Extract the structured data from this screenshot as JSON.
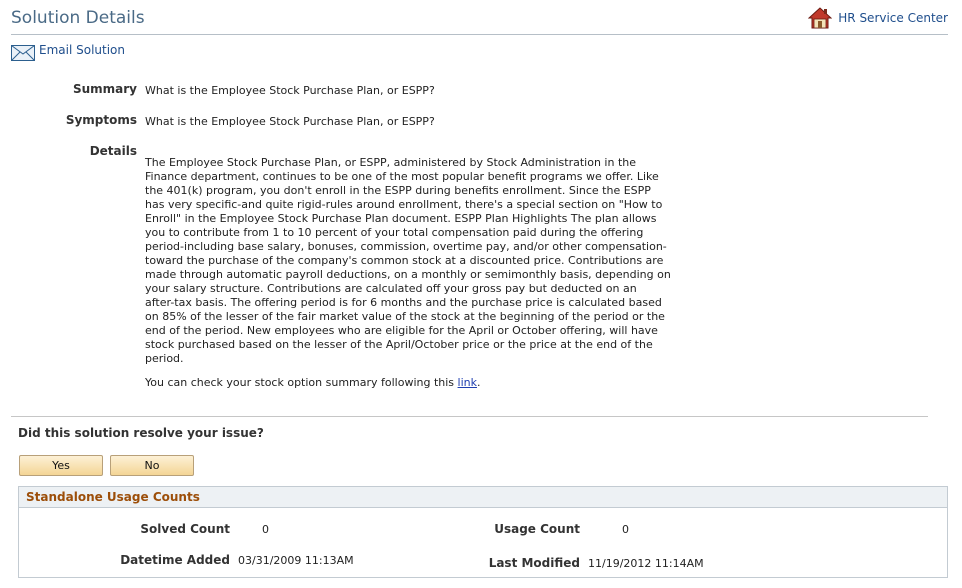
{
  "header": {
    "title": "Solution Details",
    "hr_link": "HR Service Center"
  },
  "actions": {
    "email": "Email Solution"
  },
  "fields": {
    "summary_label": "Summary",
    "summary_value": "What is the Employee Stock Purchase Plan, or ESPP?",
    "symptoms_label": "Symptoms",
    "symptoms_value": "What is the Employee Stock Purchase Plan, or ESPP?",
    "details_label": "Details",
    "details_lines": [
      "The Employee Stock Purchase Plan, or ESPP, administered by Stock Administration in the",
      "Finance department, continues to be one of the most popular benefit programs we offer. Like",
      "the 401(k) program, you don't enroll in the ESPP during benefits enrollment. Since the ESPP",
      "has very specific-and quite rigid-rules around enrollment, there's a special section on \"How to",
      "Enroll\" in the Employee Stock Purchase Plan document. ESPP Plan Highlights The plan allows",
      "you to contribute from 1 to 10 percent of your total compensation paid during the offering",
      "period-including base salary, bonuses, commission, overtime pay, and/or other compensation-",
      "toward the purchase of the company's common stock at a discounted price. Contributions are",
      "made through automatic payroll deductions, on a monthly or semimonthly basis, depending on",
      "your salary structure. Contributions are calculated off your gross pay but deducted on an",
      "after-tax basis. The offering period is for 6 months and the purchase price is calculated based",
      "on 85% of the lesser of the fair market value of the stock at the beginning of the period or the",
      "end of the period. New employees who are eligible for the April or October offering, will have",
      "stock purchased based on the lesser of the April/October price or the price at the end of the",
      "period."
    ],
    "check_prefix": "You can check your stock option summary following this ",
    "check_link": "link",
    "check_suffix": "."
  },
  "feedback": {
    "question": "Did this solution resolve your issue?",
    "yes": "Yes",
    "no": "No"
  },
  "usage": {
    "title": "Standalone Usage Counts",
    "solved_label": "Solved Count",
    "solved_value": "0",
    "usage_label": "Usage Count",
    "usage_value": "0",
    "added_label": "Datetime Added",
    "added_value": "03/31/2009 11:13AM",
    "modified_label": "Last Modified",
    "modified_value": "11/19/2012 11:14AM"
  },
  "colors": {
    "title": "#4a6a86",
    "link": "#1f4e8c",
    "group_title": "#9c4e09",
    "button": "#f4d595"
  },
  "icons": [
    "home-icon",
    "email-icon"
  ]
}
